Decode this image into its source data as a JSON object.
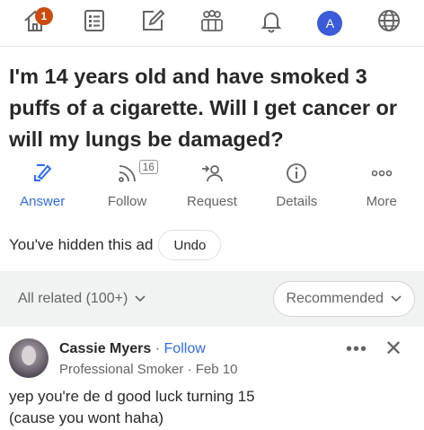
{
  "nav": {
    "home_badge": "1",
    "avatar_letter": "A",
    "icons": [
      "home-icon",
      "list-icon",
      "edit-icon",
      "people-icon",
      "bell-icon",
      "avatar",
      "globe-icon"
    ]
  },
  "question": {
    "title": "I'm 14 years old and have smoked 3 puffs of a cigarette. Will I get cancer or will my lungs be damaged?"
  },
  "actions": {
    "answer": "Answer",
    "follow": "Follow",
    "follow_count": "16",
    "request": "Request",
    "details": "Details",
    "more": "More"
  },
  "ad": {
    "text": "You've hidden this ad",
    "undo": "Undo"
  },
  "filters": {
    "related": "All related (100+)",
    "sort": "Recommended"
  },
  "answer": {
    "author": "Cassie Myers",
    "separator": "·",
    "follow": "Follow",
    "credential": "Professional Smoker · Feb 10",
    "text_line1": "yep you're de  d good luck turning 15",
    "text_line2": "(cause you wont haha)"
  },
  "colors": {
    "accent_blue": "#2e69ff",
    "badge_red": "#cb4b10",
    "avatar_blue": "#3b5bdb",
    "filter_bg": "#f1f2f2"
  }
}
